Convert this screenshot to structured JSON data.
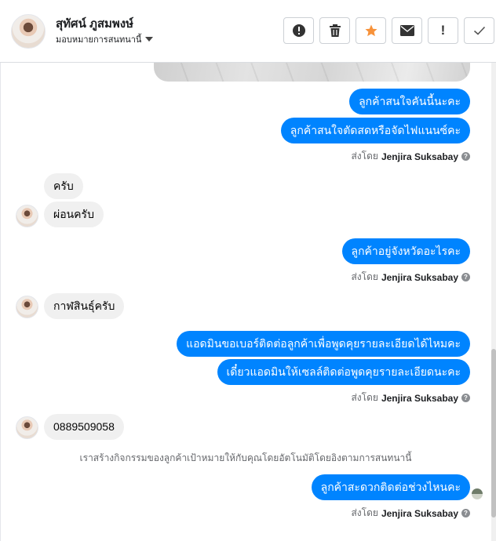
{
  "header": {
    "contact_name": "สุทัศน์ ภูสมพงษ์",
    "assign_label": "มอบหมายการสนทนานี้"
  },
  "toolbar": {
    "buttons": [
      {
        "icon": "alert-circle-icon"
      },
      {
        "icon": "trash-icon"
      },
      {
        "icon": "star-icon",
        "color": "#f7923a"
      },
      {
        "icon": "envelope-icon"
      },
      {
        "icon": "exclamation-icon",
        "label": "!"
      },
      {
        "icon": "check-icon"
      }
    ]
  },
  "messages": {
    "out_1": "ลูกค้าสนใจคันนี้นะคะ",
    "out_2": "ลูกค้าสนใจตัดสดหรือจัดไฟแนนซ์คะ",
    "in_1": "ครับ",
    "in_2": "ผ่อนครับ",
    "out_3": "ลูกค้าอยู่จังหวัดอะไรคะ",
    "in_3": "กาฬสินธุ์ครับ",
    "out_4": "แอดมินขอเบอร์ติดต่อลูกค้าเพื่อพูดคุยรายละเอียดได้ไหมคะ",
    "out_5": "เดี๋ยวแอดมินให้เซลล์ติดต่อพูดคุยรายละเอียดนะคะ",
    "in_4": "0889509058",
    "system_note": "เราสร้างกิจกรรมของลูกค้าเป้าหมายให้กับคุณโดยอัตโนมัติโดยอิงตามการสนทนานี้",
    "out_6": "ลูกค้าสะดวกติดต่อช่วงไหนคะ"
  },
  "sender": {
    "prefix": "ส่งโดย",
    "name": "Jenjira Suksabay",
    "help_glyph": "?"
  },
  "colors": {
    "outgoing_bubble": "#0084ff",
    "incoming_bubble": "#f0f0f0",
    "star": "#f7923a"
  }
}
